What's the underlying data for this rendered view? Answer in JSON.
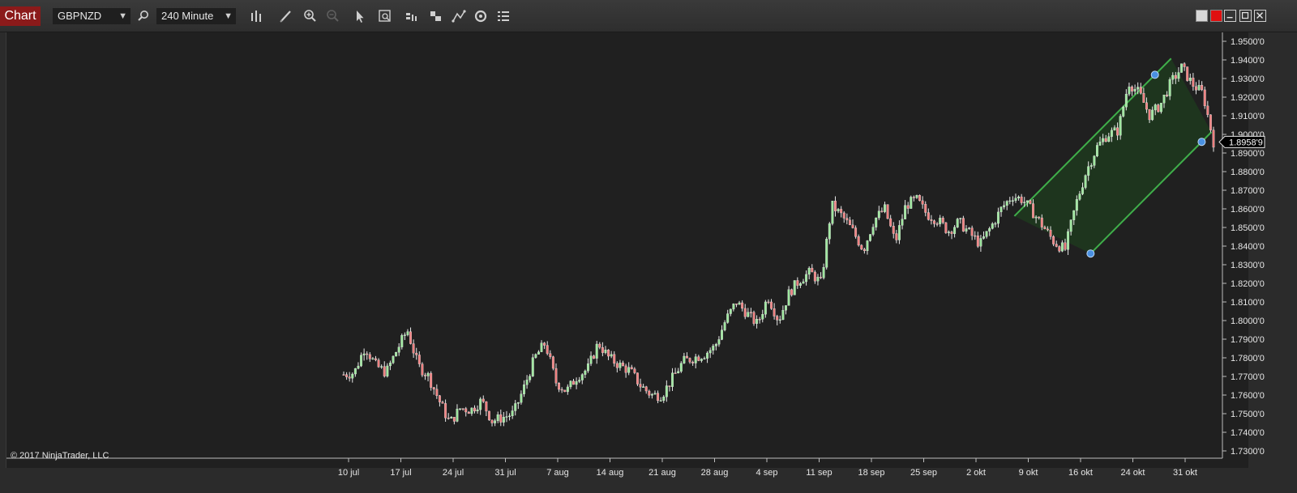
{
  "toolbar": {
    "chart_tab_label": "Chart",
    "instrument": "GBPNZD",
    "interval": "240 Minute",
    "icons": [
      "search-icon",
      "bar-type-icon",
      "pencil-icon",
      "zoom-in-icon",
      "zoom-out-icon",
      "pointer-icon",
      "data-box-icon",
      "indicators-icon",
      "strategies-icon",
      "drawing-tools-icon",
      "refresh-icon",
      "properties-list-icon"
    ],
    "window_controls": [
      "link-icon",
      "color-box-icon",
      "minimize-icon",
      "maximize-icon",
      "close-icon"
    ]
  },
  "copyright": "© 2017 NinjaTrader, LLC",
  "colors": {
    "up_candle": "#9fe89f",
    "down_candle": "#f08080",
    "wick": "#e8e8e8",
    "channel_fill": "#1f3a1f",
    "channel_line": "#3fae4a",
    "anchor": "#4a90e2",
    "background": "#202020",
    "tab": "#8b1a1a"
  },
  "chart_data": {
    "type": "candlestick",
    "instrument": "GBPNZD",
    "interval": "240 Minute",
    "ylim": [
      1.725,
      1.955
    ],
    "y_ticks": [
      "1.9500'0",
      "1.9400'0",
      "1.9300'0",
      "1.9200'0",
      "1.9100'0",
      "1.9000'0",
      "1.8900'0",
      "1.8800'0",
      "1.8700'0",
      "1.8600'0",
      "1.8500'0",
      "1.8400'0",
      "1.8300'0",
      "1.8200'0",
      "1.8100'0",
      "1.8000'0",
      "1.7900'0",
      "1.7800'0",
      "1.7700'0",
      "1.7600'0",
      "1.7500'0",
      "1.7400'0",
      "1.7300'0"
    ],
    "x_ticks": [
      "10 jul",
      "17 jul",
      "24 jul",
      "31 jul",
      "7 aug",
      "14 aug",
      "21 aug",
      "28 aug",
      "4 sep",
      "11 sep",
      "18 sep",
      "25 sep",
      "2 okt",
      "9 okt",
      "16 okt",
      "24 okt",
      "31 okt"
    ],
    "last_price_label": "1.8958'9",
    "last_price": 1.8959,
    "close_path": [
      [
        "10 jul",
        1.771
      ],
      [
        "10 jul+",
        1.772
      ],
      [
        "12 jul",
        1.786
      ],
      [
        "14 jul",
        1.776
      ],
      [
        "17 jul",
        1.772
      ],
      [
        "17 jul+",
        1.784
      ],
      [
        "19 jul",
        1.795
      ],
      [
        "20 jul",
        1.776
      ],
      [
        "21 jul",
        1.77
      ],
      [
        "24 jul",
        1.757
      ],
      [
        "25 jul",
        1.745
      ],
      [
        "26 jul",
        1.753
      ],
      [
        "27 jul",
        1.752
      ],
      [
        "28 jul",
        1.757
      ],
      [
        "31 jul",
        1.746
      ],
      [
        "1 aug",
        1.748
      ],
      [
        "2 aug",
        1.75
      ],
      [
        "3 aug",
        1.764
      ],
      [
        "4 aug",
        1.78
      ],
      [
        "5 aug",
        1.788
      ],
      [
        "7 aug",
        1.767
      ],
      [
        "8 aug",
        1.762
      ],
      [
        "9 aug",
        1.77
      ],
      [
        "11 aug",
        1.774
      ],
      [
        "14 aug",
        1.788
      ],
      [
        "15 aug",
        1.78
      ],
      [
        "17 aug",
        1.776
      ],
      [
        "18 aug",
        1.773
      ],
      [
        "21 aug",
        1.765
      ],
      [
        "22 aug",
        1.76
      ],
      [
        "24 aug",
        1.76
      ],
      [
        "25 aug",
        1.769
      ],
      [
        "28 aug",
        1.778
      ],
      [
        "30 aug",
        1.78
      ],
      [
        "31 aug",
        1.782
      ],
      [
        "1 sep",
        1.786
      ],
      [
        "4 sep",
        1.8
      ],
      [
        "5 sep",
        1.81
      ],
      [
        "6 sep",
        1.804
      ],
      [
        "7 sep",
        1.798
      ],
      [
        "8 sep",
        1.813
      ],
      [
        "11 sep",
        1.8
      ],
      [
        "12 sep",
        1.815
      ],
      [
        "13 sep",
        1.822
      ],
      [
        "14 sep",
        1.826
      ],
      [
        "15 sep",
        1.82
      ],
      [
        "18 sep",
        1.862
      ],
      [
        "19 sep",
        1.856
      ],
      [
        "20 sep",
        1.848
      ],
      [
        "21 sep",
        1.838
      ],
      [
        "22 sep",
        1.854
      ],
      [
        "25 sep",
        1.86
      ],
      [
        "26 sep",
        1.842
      ],
      [
        "27 sep",
        1.862
      ],
      [
        "28 sep",
        1.865
      ],
      [
        "29 sep",
        1.857
      ],
      [
        "2 okt",
        1.854
      ],
      [
        "3 okt",
        1.848
      ],
      [
        "4 okt",
        1.853
      ],
      [
        "5 okt",
        1.847
      ],
      [
        "6 okt",
        1.841
      ],
      [
        "9 okt",
        1.85
      ],
      [
        "10 okt",
        1.86
      ],
      [
        "11 okt",
        1.867
      ],
      [
        "12 okt",
        1.865
      ],
      [
        "13 okt",
        1.858
      ],
      [
        "16 okt",
        1.85
      ],
      [
        "17 okt",
        1.842
      ],
      [
        "18 okt",
        1.838
      ],
      [
        "19 okt",
        1.862
      ],
      [
        "20 okt",
        1.88
      ],
      [
        "21 okt",
        1.893
      ],
      [
        "23 okt",
        1.9
      ],
      [
        "24 okt",
        1.902
      ],
      [
        "25 okt",
        1.928
      ],
      [
        "26 okt",
        1.922
      ],
      [
        "27 okt",
        1.91
      ],
      [
        "30 okt",
        1.916
      ],
      [
        "31 okt",
        1.928
      ],
      [
        "1 nov",
        1.936
      ],
      [
        "1 nov+",
        1.927
      ],
      [
        "2 nov",
        1.922
      ],
      [
        "2 nov+",
        1.896
      ]
    ],
    "channel": {
      "anchor_1": [
        "13 okt",
        1.836
      ],
      "anchor_2": [
        "24 okt",
        1.932
      ],
      "anchor_3": [
        "2 nov",
        1.896
      ]
    }
  }
}
